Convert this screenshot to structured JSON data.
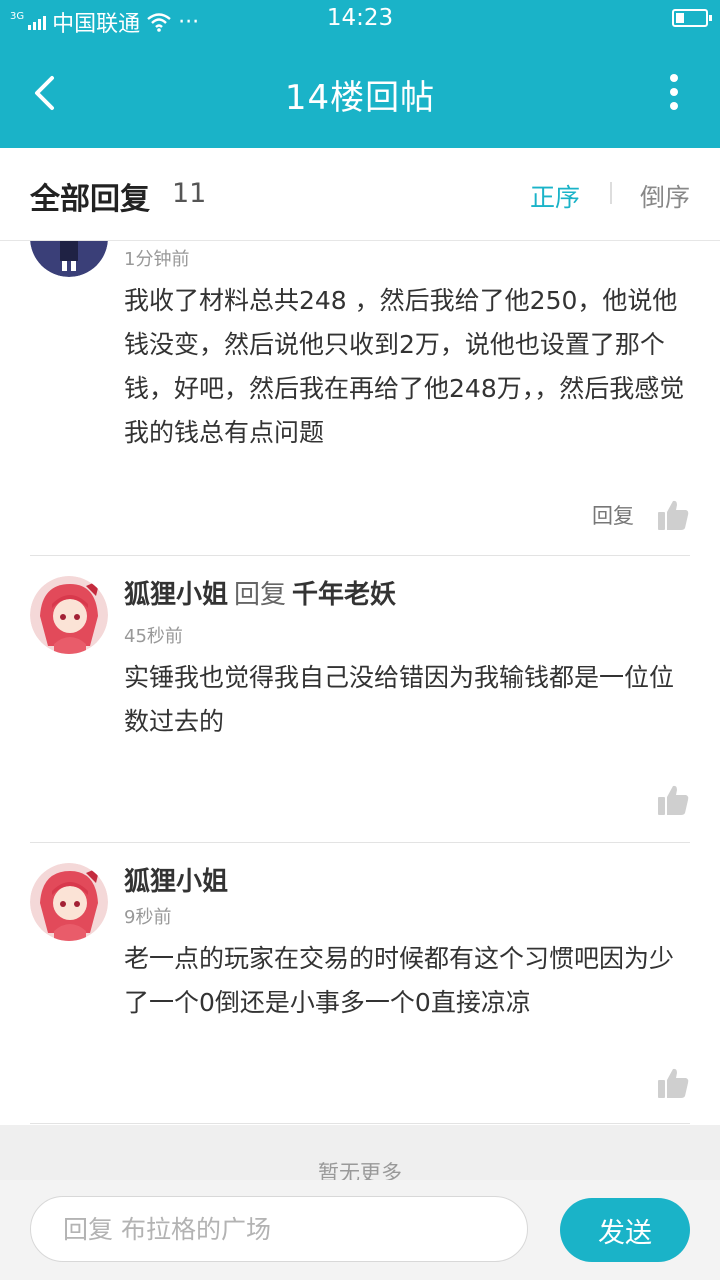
{
  "status_bar": {
    "network": "3G",
    "carrier": "中国联通",
    "dots": "···",
    "time": "14:23"
  },
  "nav": {
    "title": "14楼回帖"
  },
  "reply_header": {
    "label": "全部回复",
    "count": "11",
    "sort_asc": "正序",
    "sort_desc": "倒序"
  },
  "replies": [
    {
      "time": "1分钟前",
      "content": "我收了材料总共248 ，然后我给了他250，他说他钱没变，然后说他只收到2万，说他也设置了那个钱，好吧，然后我在再给了他248万，，然后我感觉我的钱总有点问题",
      "reply_label": "回复"
    },
    {
      "username": "狐狸小姐",
      "reply_word": "回复",
      "reply_to": "千年老妖",
      "time": "45秒前",
      "content": "实锤我也觉得我自己没给错因为我输钱都是一位位数过去的"
    },
    {
      "username": "狐狸小姐",
      "time": "9秒前",
      "content": "老一点的玩家在交易的时候都有这个习惯吧因为少了一个0倒还是小事多一个0直接凉凉"
    }
  ],
  "footer": {
    "no_more": "暂无更多"
  },
  "input": {
    "placeholder": "回复 布拉格的广场",
    "send_label": "发送"
  },
  "colors": {
    "accent": "#1ab3c8",
    "text": "#333333",
    "muted": "#999999"
  }
}
